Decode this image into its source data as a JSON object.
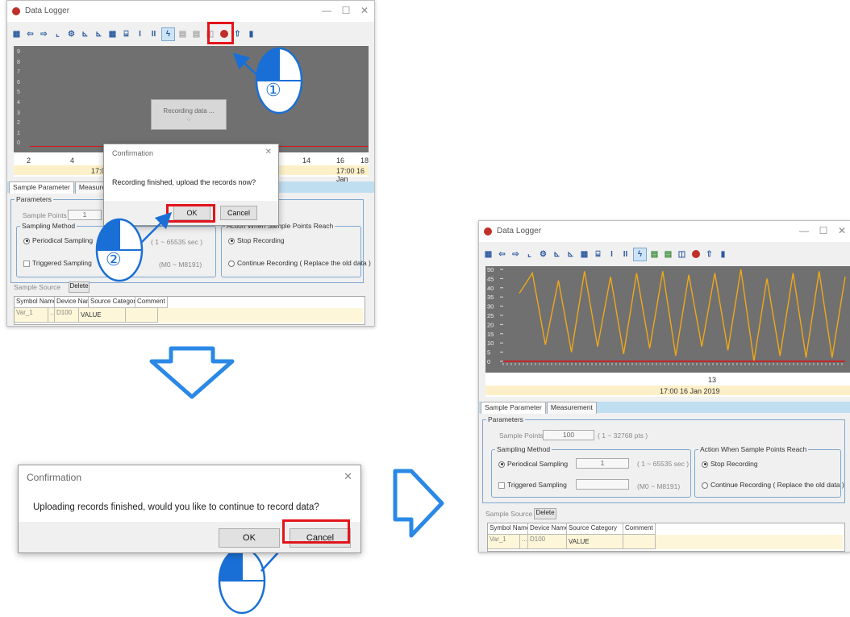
{
  "window_title": "Data Logger",
  "window_controls": {
    "minimize": "—",
    "maximize": "☐",
    "close": "✕"
  },
  "toolbar_icons": [
    "save-icon",
    "import-icon",
    "export-icon",
    "line-chart-icon",
    "gear-icon",
    "axis-icon",
    "axis-icon",
    "grid-icon",
    "cursor-icon",
    "cursor-i-icon",
    "cursor-ii-icon",
    "auto-scale-icon",
    "upload-icon",
    "download-icon",
    "monitor-icon",
    "record-icon",
    "plc-upload-icon",
    "plc-icon"
  ],
  "top_window": {
    "recording_msg": "Recording data ...",
    "y_ticks": [
      "9",
      "8",
      "7",
      "6",
      "5",
      "4",
      "3",
      "2",
      "1",
      "0"
    ],
    "x_ticks": [
      "2",
      "4",
      "14",
      "16",
      "18"
    ],
    "time_label": "17:00",
    "time_label_right": "17:00 16  Jan"
  },
  "tabs": {
    "sample_parameter": "Sample Parameter",
    "measurement": "Measurement"
  },
  "params": {
    "group": "Parameters",
    "sample_points_label": "Sample Points",
    "sample_points_value": "100",
    "sample_points_value_top": "1",
    "sample_points_range": "( 1 ~ 32768 pts )",
    "sampling_method": "Sampling Method",
    "periodical": "Periodical Sampling",
    "periodical_value": "1",
    "periodical_range": "( 1 ~ 65535 sec )",
    "triggered": "Triggered Sampling",
    "triggered_range": "(M0 ~ M8191)",
    "action_group": "Action When Sample Points Reach",
    "action_group_top": "Action When Sample Points Reach",
    "stop_recording": "Stop Recording",
    "continue_recording": "Continue Recording ( Replace the old data )"
  },
  "source": {
    "sample_source": "Sample Source",
    "delete": "Delete",
    "headers": [
      "Symbol Name",
      "Device Name",
      "Source Category",
      "Comment"
    ],
    "row": {
      "symbol": "Var_1",
      "browse": "...",
      "device": "D100",
      "category": "VALUE",
      "comment": ""
    }
  },
  "dialog1": {
    "title": "Confirmation",
    "close": "✕",
    "message": "Recording finished, upload the records now?",
    "ok": "OK",
    "cancel": "Cancel"
  },
  "dialog2": {
    "title": "Confirmation",
    "close": "✕",
    "message": "Uploading records finished, would you like to continue to record data?",
    "ok": "OK",
    "cancel": "Cancel"
  },
  "step_markers": {
    "step1": "①",
    "step2": "②"
  },
  "right_window": {
    "y_ticks": [
      "50",
      "45",
      "40",
      "35",
      "30",
      "25",
      "20",
      "15",
      "10",
      "5",
      "0"
    ],
    "x_tick": "13",
    "time_label": "17:00 16  Jan  2019"
  },
  "chart_data": {
    "type": "line",
    "title": "",
    "xlabel": "",
    "ylabel": "",
    "ylim": [
      0,
      50
    ],
    "x_tick_labels": [
      "13"
    ],
    "series": [
      {
        "color": "#f0a818",
        "values": [
          37,
          48,
          9,
          44,
          5,
          49,
          8,
          46,
          4,
          48,
          7,
          49,
          3,
          47,
          8,
          48,
          6,
          50,
          0,
          45,
          3,
          48,
          2,
          49,
          2,
          46
        ]
      },
      {
        "color": "#e01010",
        "values": [
          0,
          0
        ]
      }
    ]
  },
  "colors": {
    "accent_red": "#e3141b",
    "arrow_blue": "#1a6fd6",
    "chart_bg": "#707070",
    "line": "#f0a818"
  }
}
